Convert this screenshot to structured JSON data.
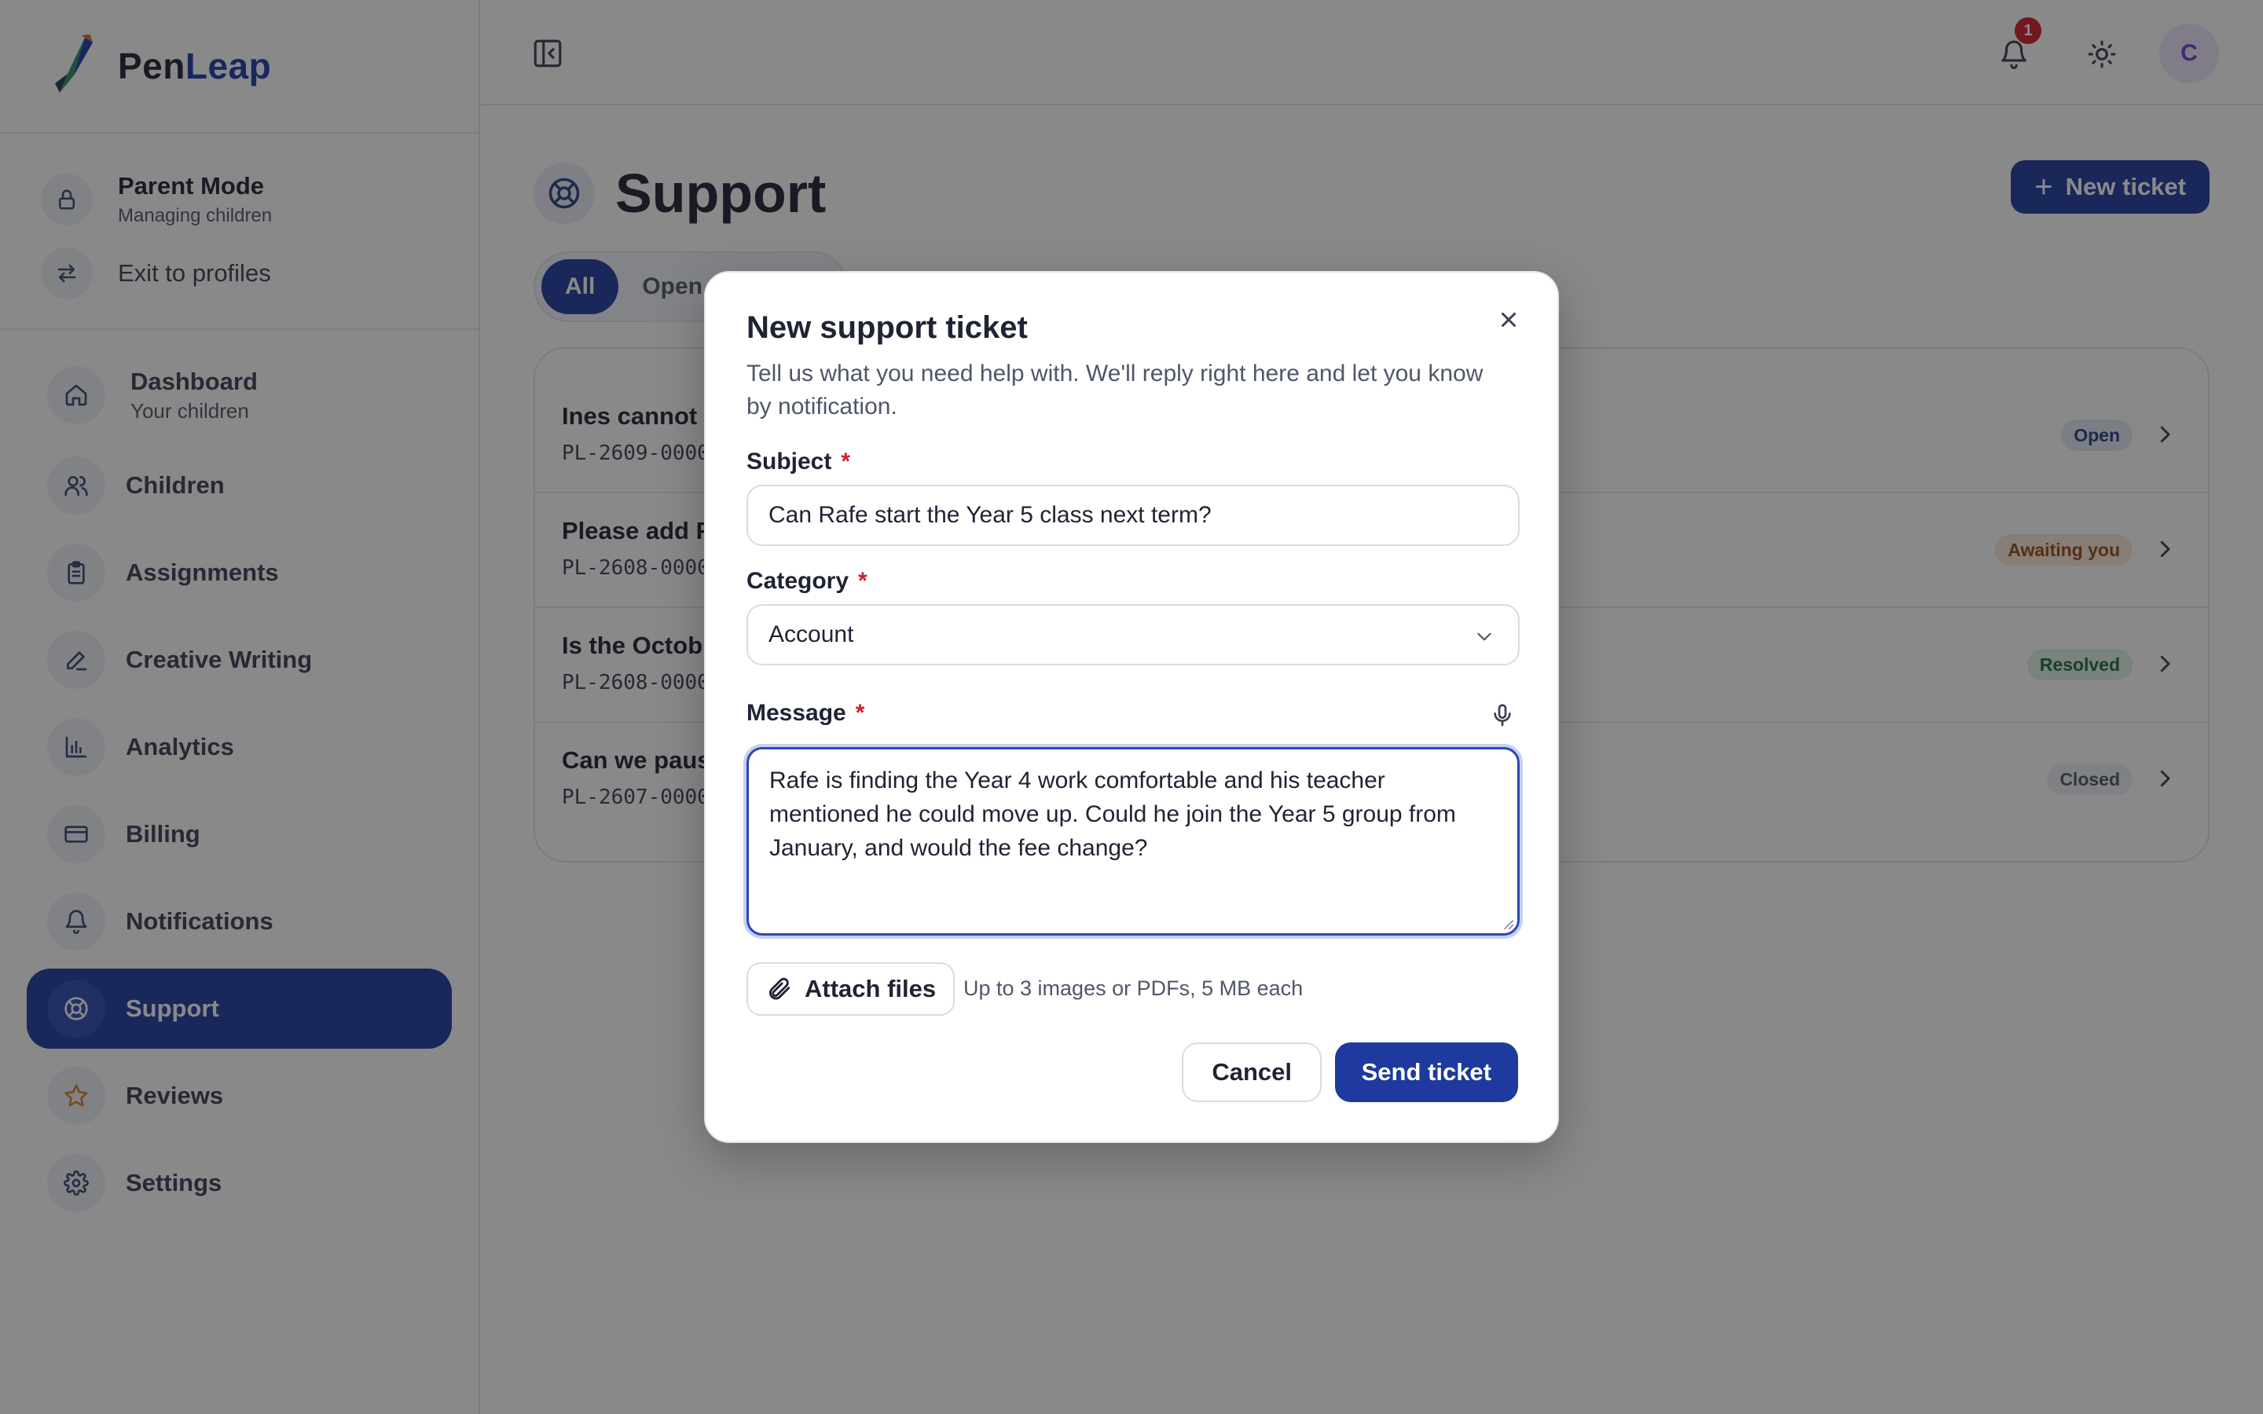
{
  "brand": {
    "name_part1": "Pen",
    "name_part2": "Leap"
  },
  "parent_mode": {
    "title": "Parent Mode",
    "subtitle": "Managing children",
    "exit_label": "Exit to profiles"
  },
  "sidebar": {
    "items": [
      {
        "label": "Dashboard",
        "sublabel": "Your children",
        "icon": "home-icon"
      },
      {
        "label": "Children",
        "icon": "users-icon"
      },
      {
        "label": "Assignments",
        "icon": "clipboard-icon"
      },
      {
        "label": "Creative Writing",
        "icon": "pencil-icon"
      },
      {
        "label": "Analytics",
        "icon": "bar-chart-icon"
      },
      {
        "label": "Billing",
        "icon": "credit-card-icon"
      },
      {
        "label": "Notifications",
        "icon": "bell-icon"
      },
      {
        "label": "Support",
        "icon": "lifebuoy-icon",
        "active": true
      },
      {
        "label": "Reviews",
        "icon": "star-icon"
      },
      {
        "label": "Settings",
        "icon": "gear-icon"
      }
    ]
  },
  "topbar": {
    "notification_count": "1",
    "avatar_initial": "C"
  },
  "page": {
    "title": "Support",
    "new_ticket_label": "New ticket",
    "tabs": [
      {
        "label": "All",
        "active": true
      },
      {
        "label": "Open"
      }
    ]
  },
  "tickets": [
    {
      "title": "Ines cannot",
      "ref": "PL-2609-0000",
      "status": "Open",
      "status_bg": "#e4e9f5",
      "status_color": "#2a3f7e"
    },
    {
      "title": "Please add F",
      "ref": "PL-2608-0000",
      "status": "Awaiting you",
      "status_bg": "#f8e9d9",
      "status_color": "#9a4a0e"
    },
    {
      "title": "Is the Octob",
      "ref": "PL-2608-0000",
      "status": "Resolved",
      "status_bg": "#dff1e5",
      "status_color": "#1e6b3a"
    },
    {
      "title": "Can we paus",
      "ref": "PL-2607-0000",
      "status": "Closed",
      "status_bg": "#eceef2",
      "status_color": "#50566a"
    }
  ],
  "modal": {
    "title": "New support ticket",
    "description": "Tell us what you need help with. We'll reply right here and let you know by notification.",
    "subject_label": "Subject",
    "subject_value": "Can Rafe start the Year 5 class next term?",
    "category_label": "Category",
    "category_value": "Account",
    "message_label": "Message",
    "message_value": "Rafe is finding the Year 4 work comfortable and his teacher mentioned he could move up. Could he join the Year 5 group from January, and would the fee change?",
    "required_mark": "*",
    "attach_label": "Attach files",
    "attach_hint": "Up to 3 images or PDFs, 5 MB each",
    "cancel_label": "Cancel",
    "send_label": "Send ticket"
  },
  "colors": {
    "primary": "#1e3a9f",
    "required": "#d21d2b",
    "badge": "#d21d2b"
  }
}
